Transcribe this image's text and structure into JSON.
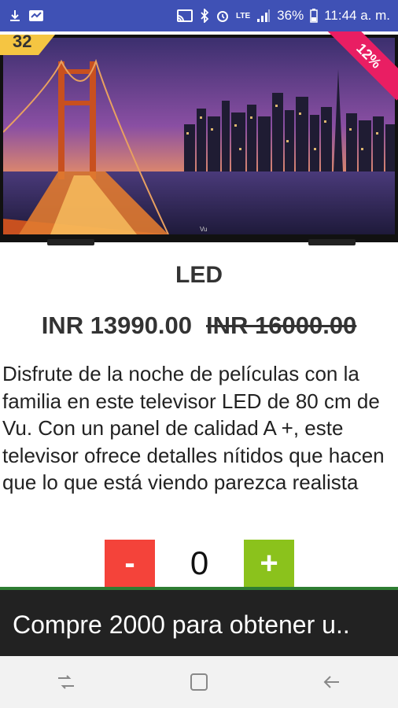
{
  "status_bar": {
    "battery": "36%",
    "time": "11:44 a. m.",
    "network": "LTE",
    "icons": [
      "download-icon",
      "activity-icon",
      "cast-icon",
      "bluetooth-icon",
      "alarm-icon",
      "signal-icon",
      "battery-icon"
    ]
  },
  "product": {
    "size_badge": "32",
    "discount": "12%",
    "title": "LED",
    "price": "INR 13990.00",
    "old_price": "INR 16000.00",
    "description": "Disfrute de la noche de películas con la familia en este televisor LED de 80 cm de Vu. Con un panel de calidad A +, este televisor ofrece detalles nítidos que hacen que lo que está viendo parezca realista"
  },
  "quantity": {
    "minus_label": "-",
    "value": "0",
    "plus_label": "+"
  },
  "banner": {
    "text": "Compre 2000 para obtener u.."
  },
  "nav_bar": {
    "buttons": [
      "recents-icon",
      "home-icon",
      "back-icon"
    ]
  },
  "colors": {
    "status_bar": "#3f51b5",
    "minus_button": "#f4433a",
    "plus_button": "#8bc21c",
    "banner_bg": "#222222",
    "banner_border": "#2e7d32",
    "discount_ribbon": "#e91e63",
    "size_badge": "#f5c542"
  }
}
